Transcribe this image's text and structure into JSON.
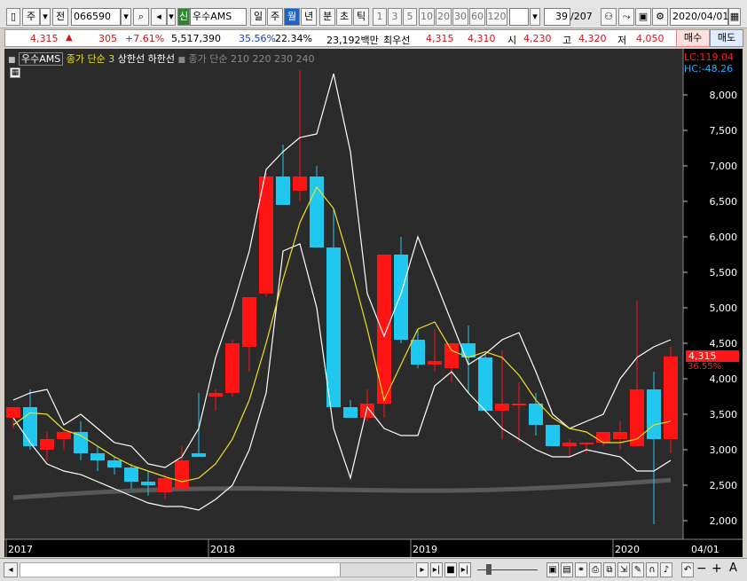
{
  "toolbar": {
    "market": "주",
    "scope": "전",
    "code": "066590",
    "badge": "신",
    "name": "우수AMS",
    "periods": [
      "일",
      "주",
      "월",
      "년"
    ],
    "active_period": "월",
    "intervals": [
      "분",
      "초",
      "틱"
    ],
    "counts": [
      "1",
      "3",
      "5",
      "10",
      "20",
      "30",
      "60",
      "120"
    ],
    "range": "39",
    "range_total": "/207",
    "date": "2020/04/01"
  },
  "price_bar": {
    "price": "4,315",
    "change": "305",
    "change_pct": "+7.61%",
    "volume": "5,517,390",
    "turnover_pct": "35.56%",
    "ratio": "22.34%",
    "amount": "23,192백만",
    "bid_label": "최우선",
    "bid1": "4,315",
    "bid2": "4,310",
    "open_label": "시",
    "open": "4,230",
    "high_label": "고",
    "high": "4,320",
    "low_label": "저",
    "low": "4,050",
    "buy": "매수",
    "sell": "매도"
  },
  "legend": {
    "name": "우수AMS",
    "ma": "종가 단순 3",
    "upper": "상한선",
    "lower": "하한선",
    "ma_long": "종가 단순 210  220  230  240"
  },
  "indicators": {
    "lc": "LC:119.04",
    "hc": "HC:-48.26"
  },
  "current": {
    "price": "4,315",
    "pct": "36.55%"
  },
  "chart_data": {
    "type": "candlestick",
    "x": [
      "2017-01",
      "2017-02",
      "2017-03",
      "2017-04",
      "2017-05",
      "2017-06",
      "2017-07",
      "2017-08",
      "2017-09",
      "2017-10",
      "2017-11",
      "2017-12",
      "2018-01",
      "2018-02",
      "2018-03",
      "2018-04",
      "2018-05",
      "2018-06",
      "2018-07",
      "2018-08",
      "2018-09",
      "2018-10",
      "2018-11",
      "2018-12",
      "2019-01",
      "2019-02",
      "2019-03",
      "2019-04",
      "2019-05",
      "2019-06",
      "2019-07",
      "2019-08",
      "2019-09",
      "2019-10",
      "2019-11",
      "2019-12",
      "2020-01",
      "2020-02",
      "2020-03",
      "2020-04"
    ],
    "ohlc": [
      [
        3450,
        3600,
        3300,
        3600
      ],
      [
        3600,
        3850,
        3000,
        3050
      ],
      [
        3000,
        3250,
        2850,
        3150
      ],
      [
        3150,
        3300,
        3000,
        3250
      ],
      [
        3250,
        3400,
        2850,
        2950
      ],
      [
        2950,
        3050,
        2700,
        2850
      ],
      [
        2850,
        2900,
        2650,
        2750
      ],
      [
        2750,
        2800,
        2450,
        2550
      ],
      [
        2550,
        2700,
        2350,
        2500
      ],
      [
        2400,
        2650,
        2300,
        2600
      ],
      [
        2450,
        3050,
        2450,
        2850
      ],
      [
        2950,
        3800,
        2900,
        2900
      ],
      [
        3750,
        3850,
        3550,
        3800
      ],
      [
        3800,
        4550,
        3750,
        4500
      ],
      [
        4450,
        4850,
        4100,
        5150
      ],
      [
        5200,
        6900,
        5150,
        6850
      ],
      [
        6850,
        7300,
        6500,
        6450
      ],
      [
        6650,
        8350,
        6500,
        6850
      ],
      [
        6850,
        7000,
        5850,
        5850
      ],
      [
        5850,
        6400,
        3600,
        3600
      ],
      [
        3600,
        3700,
        3450,
        3450
      ],
      [
        3450,
        3850,
        3400,
        3650
      ],
      [
        3650,
        5750,
        3450,
        5750
      ],
      [
        5750,
        6000,
        4500,
        4550
      ],
      [
        4550,
        4700,
        4150,
        4200
      ],
      [
        4200,
        4700,
        4100,
        4250
      ],
      [
        4150,
        4500,
        3950,
        4500
      ],
      [
        4500,
        4750,
        3800,
        4300
      ],
      [
        4300,
        4350,
        3550,
        3550
      ],
      [
        3550,
        4400,
        3150,
        3650
      ],
      [
        3650,
        3950,
        3100,
        3650
      ],
      [
        3650,
        3800,
        3200,
        3350
      ],
      [
        3350,
        3350,
        3050,
        3050
      ],
      [
        3050,
        3150,
        2900,
        3100
      ],
      [
        3100,
        3100,
        2950,
        3100
      ],
      [
        3100,
        3250,
        3050,
        3250
      ],
      [
        3150,
        3400,
        3000,
        3250
      ],
      [
        3050,
        5100,
        3050,
        3850
      ],
      [
        3850,
        4100,
        1950,
        3150
      ],
      [
        3150,
        4450,
        2950,
        4315
      ]
    ],
    "ma3": [
      3350,
      3520,
      3500,
      3280,
      3200,
      3050,
      2900,
      2780,
      2700,
      2620,
      2550,
      2600,
      2800,
      3150,
      3700,
      4500,
      5400,
      6200,
      6700,
      6400,
      5600,
      4700,
      3700,
      4200,
      4700,
      4800,
      4400,
      4300,
      4380,
      4300,
      4050,
      3700,
      3450,
      3300,
      3250,
      3100,
      3100,
      3150,
      3350,
      3400,
      3700
    ],
    "upper": [
      3700,
      3800,
      3850,
      3350,
      3500,
      3300,
      3100,
      3050,
      2800,
      2750,
      2900,
      3300,
      4300,
      5000,
      5800,
      6950,
      7200,
      7400,
      7450,
      8300,
      7200,
      5200,
      4600,
      5200,
      6000,
      5400,
      4800,
      4200,
      4350,
      4550,
      4650,
      4100,
      3500,
      3300,
      3400,
      3500,
      4000,
      4300,
      4450,
      4550
    ],
    "lower": [
      3450,
      3100,
      2800,
      2700,
      2650,
      2550,
      2450,
      2350,
      2250,
      2200,
      2200,
      2150,
      2300,
      2500,
      3000,
      3800,
      5800,
      5900,
      5000,
      3300,
      2600,
      3600,
      3300,
      3200,
      3200,
      3900,
      4100,
      3800,
      3550,
      3300,
      3150,
      3000,
      2900,
      2900,
      3000,
      2950,
      2900,
      2700,
      2700,
      2850
    ],
    "long_ma": [
      2350,
      2300,
      2250,
      2200,
      2150,
      2100
    ],
    "ylim": [
      1800,
      8500
    ],
    "y_ticks": [
      2000,
      2500,
      3000,
      3500,
      4000,
      4500,
      5000,
      5500,
      6000,
      6500,
      7000,
      7500,
      8000
    ],
    "x_ticks": [
      "2017",
      "2018",
      "2019",
      "2020",
      "04/01"
    ]
  },
  "status": {
    "zoom_minus": "−",
    "zoom_plus": "+",
    "font": "A"
  }
}
